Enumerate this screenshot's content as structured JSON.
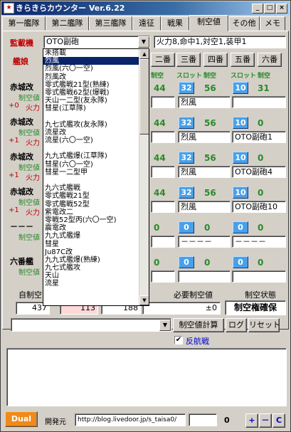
{
  "window": {
    "title": "きらきらカウンター Ver.6.22",
    "icon_glyph": "★"
  },
  "tabs": [
    "第一艦隊",
    "第二艦隊",
    "第三艦隊",
    "遠征",
    "戦果",
    "制空値",
    "その他",
    "メモ"
  ],
  "header": {
    "ship_label": "監載機",
    "ship_value": "OTO副砲",
    "stat_text": "火力8,命中1,対空1,装甲1",
    "kanmusu_label": "艦娘"
  },
  "slot_buttons": [
    "二番",
    "三番",
    "四番",
    "五番",
    "六番"
  ],
  "col_headers": {
    "seiku": "制空",
    "slot": "スロット"
  },
  "rows": [
    {
      "name": "赤城改",
      "sub1": "制空値",
      "mod": "+0",
      "sub2": "火力",
      "v1": "44",
      "slot1": "32",
      "v2": "56",
      "slot2": "10",
      "v3": "31",
      "eq1": "",
      "eq2": "烈風",
      "eq3": ""
    },
    {
      "name": "赤城改",
      "sub1": "制空値",
      "mod": "+1",
      "sub2": "火力",
      "v1": "44",
      "slot1": "32",
      "v2": "56",
      "slot2": "10",
      "v3": "0",
      "eq1": "",
      "eq2": "烈風",
      "eq3": "OTO副砲1"
    },
    {
      "name": "赤城改",
      "sub1": "制空値",
      "mod": "+1",
      "sub2": "火力",
      "v1": "44",
      "slot1": "32",
      "v2": "56",
      "slot2": "10",
      "v3": "0",
      "eq1": "",
      "eq2": "烈風",
      "eq3": "OTO副砲4"
    },
    {
      "name": "赤城改",
      "sub1": "制空値",
      "mod": "+1",
      "sub2": "火力",
      "v1": "44",
      "slot1": "32",
      "v2": "56",
      "slot2": "10",
      "v3": "0",
      "eq1": "",
      "eq2": "烈風",
      "eq3": "OTO副砲10"
    },
    {
      "name": "－－－",
      "sub1": "制空値",
      "mod": "",
      "sub2": "",
      "v1": "0",
      "slot1": "0",
      "v2": "0",
      "slot2": "0",
      "v3": "0",
      "eq1": "",
      "eq2": "－－－－",
      "eq3": "－－－－"
    },
    {
      "name": "六番艦",
      "sub1": "制空値",
      "mod": "",
      "sub2": "",
      "v1": "0",
      "slot1": "0",
      "v2": "0",
      "slot2": "0",
      "v3": "0",
      "eq1": "",
      "eq2": "",
      "eq3": ""
    }
  ],
  "dropdown_options": [
    "未搭載",
    "烈風",
    "烈風(六〇一空)",
    "烈風改",
    "零式艦戦21型(熟練)",
    "零式艦戦62型(爆戦)",
    "天山一二型(友永隊)",
    "彗星(江草隊)",
    "",
    "九七式艦攻(友永隊)",
    "流星改",
    "流星(六〇一空)",
    "",
    "九九式艦爆(江草隊)",
    "彗星(六〇一空)",
    "彗星一二型甲",
    "",
    "九六式艦戦",
    "零式艦戦21型",
    "零式艦戦52型",
    "紫電改二",
    "零戦52型丙(六〇一空)",
    "震電改",
    "九九式艦爆",
    "彗星",
    "Ju87C改",
    "九九式艦爆(熟練)",
    "九七式艦攻",
    "天山",
    "流星"
  ],
  "dropdown_selected_index": 1,
  "summary": {
    "own_label": "自制空",
    "own_value": "437",
    "need_label": "必要制空値",
    "need_value": "±0",
    "state_label": "制空状態",
    "state_value": "制空権確保",
    "extra1": "113",
    "extra2": "188"
  },
  "actions": {
    "calc": "制空値計算",
    "log": "ログ",
    "reset": "リセット",
    "checkbox_label": "反航戦",
    "checked": true
  },
  "footer": {
    "dual": "Dual",
    "dev_label": "開発元",
    "url": "http://blog.livedoor.jp/s_taisa0/",
    "counter": "0",
    "plus": "+",
    "minus": "－",
    "c": "C"
  }
}
